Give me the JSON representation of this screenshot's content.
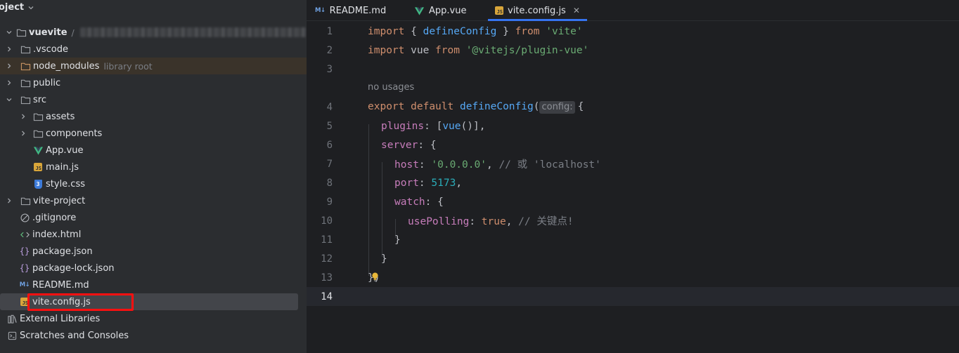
{
  "project": {
    "title": "oject",
    "root": {
      "name": "vuevite",
      "path_prefix": "/"
    },
    "items": [
      {
        "label": ".vscode"
      },
      {
        "label": "node_modules",
        "sub": "library root"
      },
      {
        "label": "public"
      },
      {
        "label": "src"
      },
      {
        "label": "assets"
      },
      {
        "label": "components"
      },
      {
        "label": "App.vue"
      },
      {
        "label": "main.js"
      },
      {
        "label": "style.css"
      },
      {
        "label": "vite-project"
      },
      {
        "label": ".gitignore"
      },
      {
        "label": "index.html"
      },
      {
        "label": "package.json"
      },
      {
        "label": "package-lock.json"
      },
      {
        "label": "README.md"
      },
      {
        "label": "vite.config.js"
      },
      {
        "label": "External Libraries"
      },
      {
        "label": "Scratches and Consoles"
      }
    ]
  },
  "tabs": [
    {
      "label": "README.md",
      "icon": "M↓"
    },
    {
      "label": "App.vue"
    },
    {
      "label": "vite.config.js",
      "icon": "JS"
    }
  ],
  "editor": {
    "usages_hint": "no usages",
    "param_hint": "config:",
    "line_numbers": [
      "1",
      "2",
      "3",
      "4",
      "5",
      "6",
      "7",
      "8",
      "9",
      "10",
      "11",
      "12",
      "13",
      "14"
    ],
    "code": {
      "l1": {
        "kw1": "import",
        "p1": " { ",
        "fn": "defineConfig",
        "p2": " } ",
        "kw2": "from",
        "sp": " ",
        "str": "'vite'"
      },
      "l2": {
        "kw1": "import",
        "id": " vue ",
        "kw2": "from",
        "sp": " ",
        "str": "'@vitejs/plugin-vue'"
      },
      "l4": {
        "kw1": "export",
        "sp": " ",
        "kw2": "default",
        "sp2": " ",
        "fn": "defineConfig",
        "p": "(",
        "brace": "{"
      },
      "l5": {
        "prop": "plugins",
        "p1": ": [",
        "fn": "vue",
        "p2": "()],"
      },
      "l6": {
        "prop": "server",
        "p": ": {"
      },
      "l7": {
        "prop": "host",
        "p1": ": ",
        "str": "'0.0.0.0'",
        "p2": ", ",
        "cmt": "// 或 'localhost'"
      },
      "l8": {
        "prop": "port",
        "p1": ": ",
        "num": "5173",
        "p2": ","
      },
      "l9": {
        "prop": "watch",
        "p": ": {"
      },
      "l10": {
        "prop": "usePolling",
        "p1": ": ",
        "kw": "true",
        "p2": ", ",
        "cmt": "// 关键点!"
      },
      "l11": {
        "p": "}"
      },
      "l12": {
        "p": "}"
      },
      "l13": {
        "p": "})"
      }
    }
  },
  "colors": {
    "keyword": "#cf8e6d",
    "function": "#56a8f5",
    "string": "#6aab73",
    "property": "#c77dbb",
    "number": "#2aacb8",
    "comment": "#7a7e85",
    "accent": "#3574f0",
    "highlight": "#ff1010"
  }
}
